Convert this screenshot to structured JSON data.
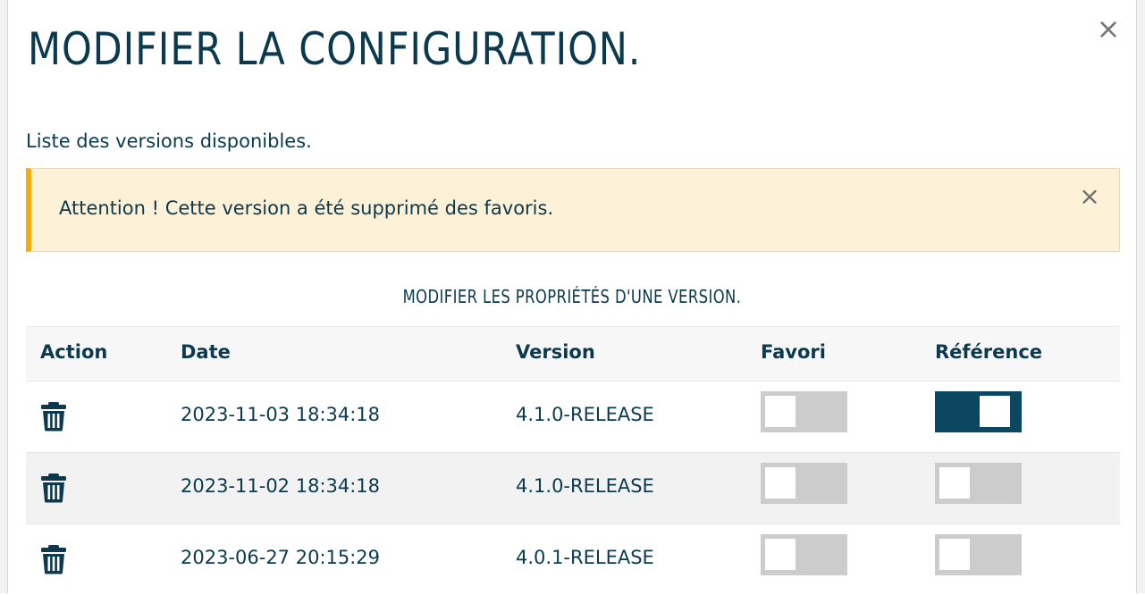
{
  "modal": {
    "title": "MODIFIER LA CONFIGURATION.",
    "close_symbol": "×",
    "subtitle": "Liste des versions disponibles."
  },
  "alert": {
    "message": "Attention ! Cette version a été supprimé des favoris.",
    "close_symbol": "×",
    "accent_color": "#f5ad0a",
    "background_color": "#fdf1d7"
  },
  "section": {
    "title": "MODIFIER LES PROPRIÉTÉS D'UNE VERSION."
  },
  "table": {
    "headers": {
      "action": "Action",
      "date": "Date",
      "version": "Version",
      "favori": "Favori",
      "reference": "Référence"
    },
    "rows": [
      {
        "date": "2023-11-03 18:34:18",
        "version": "4.1.0-RELEASE",
        "favori": false,
        "reference": true,
        "action_icon": "trash-icon"
      },
      {
        "date": "2023-11-02 18:34:18",
        "version": "4.1.0-RELEASE",
        "favori": false,
        "reference": false,
        "action_icon": "trash-icon"
      },
      {
        "date": "2023-06-27 20:15:29",
        "version": "4.0.1-RELEASE",
        "favori": false,
        "reference": false,
        "action_icon": "trash-icon"
      }
    ]
  },
  "colors": {
    "primary": "#0b3a4f",
    "toggle_on": "#0b4760",
    "toggle_off": "#cccccc"
  }
}
